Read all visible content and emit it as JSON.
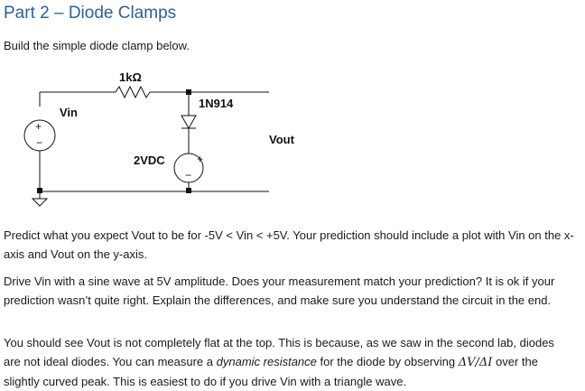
{
  "heading": "Part 2 – Diode Clamps",
  "intro": "Build the simple diode clamp below.",
  "schematic": {
    "resistor_label": "1kΩ",
    "diode_label": "1N914",
    "input_label": "Vin",
    "source_label": "2VDC",
    "output_label": "Vout",
    "source_plus": "+",
    "source_minus": "−",
    "input_plus": "+",
    "input_minus": "−",
    "icons": [
      "ac-source-icon",
      "resistor-icon",
      "diode-icon",
      "dc-source-icon",
      "ground-icon"
    ]
  },
  "paragraphs": {
    "p1": "Predict what you expect Vout to be for -5V < Vin < +5V. Your prediction should include a plot with Vin on the x-axis and Vout on the y-axis.",
    "p2": "Drive Vin with a sine wave at 5V amplitude. Does your measurement match your prediction? It is ok if your prediction wasn’t quite right. Explain the differences, and make sure you understand the circuit in the end.",
    "p3_before": "You should see Vout is not completely flat at the top. This is because, as we saw in the second lab, diodes are not ideal diodes. You can measure a ",
    "p3_emphasis": "dynamic resistance",
    "p3_middle": " for the diode by observing ",
    "p3_math": "ΔV/ΔI",
    "p3_after": " over the slightly curved peak. This is easiest to do if you drive Vin with a triangle wave."
  }
}
